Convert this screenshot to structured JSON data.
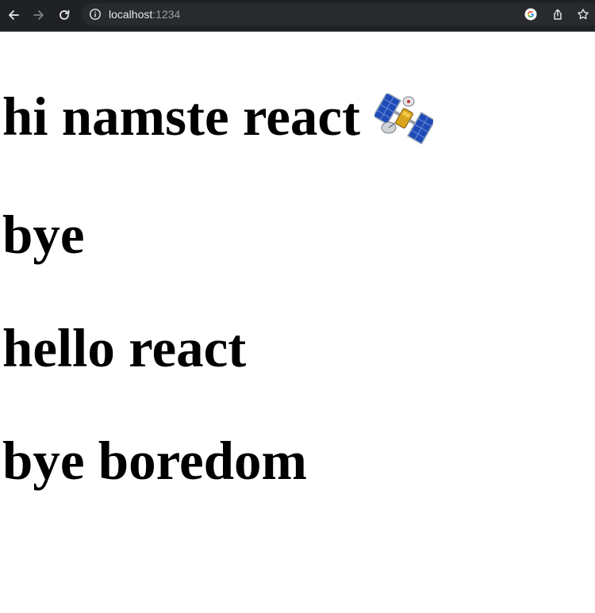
{
  "browser": {
    "url_host": "localhost",
    "url_port": ":1234",
    "icons": {
      "back": "arrow-left-icon",
      "forward": "arrow-right-icon",
      "reload": "reload-icon",
      "info": "info-icon",
      "google": "google-icon",
      "share": "share-icon",
      "bookmark": "star-icon"
    },
    "colors": {
      "toolbar": "#202124",
      "omnibox": "#282a2d",
      "text": "#e8eaed",
      "muted": "#9aa0a6"
    }
  },
  "page": {
    "headings": [
      "hi namste react",
      "bye",
      "hello react",
      "bye boredom"
    ],
    "emoji": "satellite-icon",
    "background": "#ffffff",
    "text_color": "#000000"
  }
}
